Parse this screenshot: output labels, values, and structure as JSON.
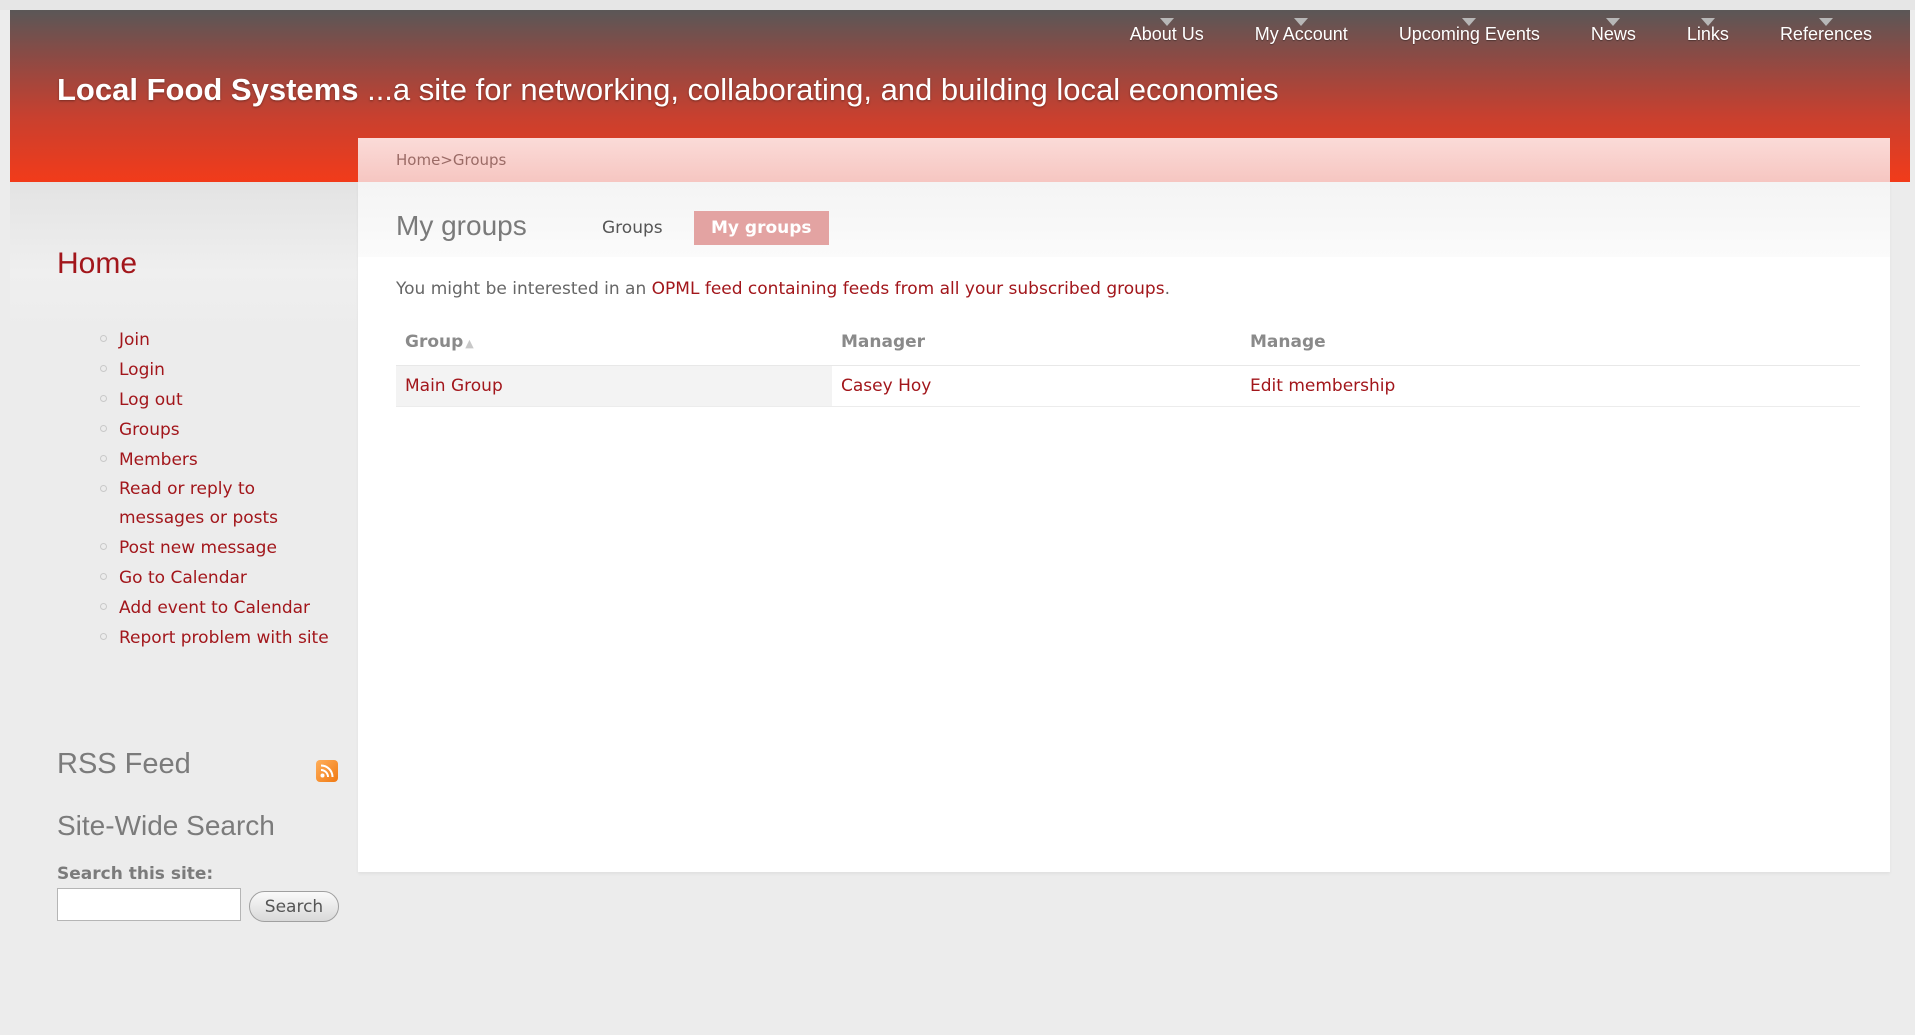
{
  "nav": {
    "items": [
      {
        "label": "About Us"
      },
      {
        "label": "My Account"
      },
      {
        "label": "Upcoming Events"
      },
      {
        "label": "News"
      },
      {
        "label": "Links"
      },
      {
        "label": "References"
      }
    ]
  },
  "site": {
    "name": "Local Food Systems",
    "tagline": " ...a site for networking, collaborating, and building local economies"
  },
  "breadcrumb": {
    "home": "Home",
    "separator": ">",
    "current": "Groups"
  },
  "sidebar": {
    "home_title": "Home",
    "menu": [
      {
        "label": "Join"
      },
      {
        "label": "Login"
      },
      {
        "label": "Log out"
      },
      {
        "label": "Groups"
      },
      {
        "label": "Members"
      },
      {
        "label": "Read or reply to messages or posts"
      },
      {
        "label": "Post new message"
      },
      {
        "label": "Go to Calendar"
      },
      {
        "label": "Add event to Calendar"
      },
      {
        "label": "Report problem with site"
      }
    ],
    "rss_title": "RSS Feed",
    "search_title": "Site-Wide Search",
    "search_label": "Search this site:",
    "search_value": "",
    "search_button": "Search"
  },
  "main": {
    "title": "My groups",
    "tabs": [
      {
        "label": "Groups",
        "active": false
      },
      {
        "label": "My groups",
        "active": true
      }
    ],
    "intro": {
      "before": "You might be interested in an ",
      "link": "OPML feed containing feeds from all your subscribed groups",
      "after": "."
    },
    "table": {
      "headers": [
        "Group",
        "Manager",
        "Manage"
      ],
      "rows": [
        {
          "group": "Main Group",
          "manager": "Casey Hoy",
          "manage": "Edit membership"
        }
      ]
    }
  },
  "colors": {
    "accent": "#a2161b",
    "header_top": "#5a5757",
    "header_bottom": "#f23b1a",
    "active_tab": "#e3a3a2"
  }
}
